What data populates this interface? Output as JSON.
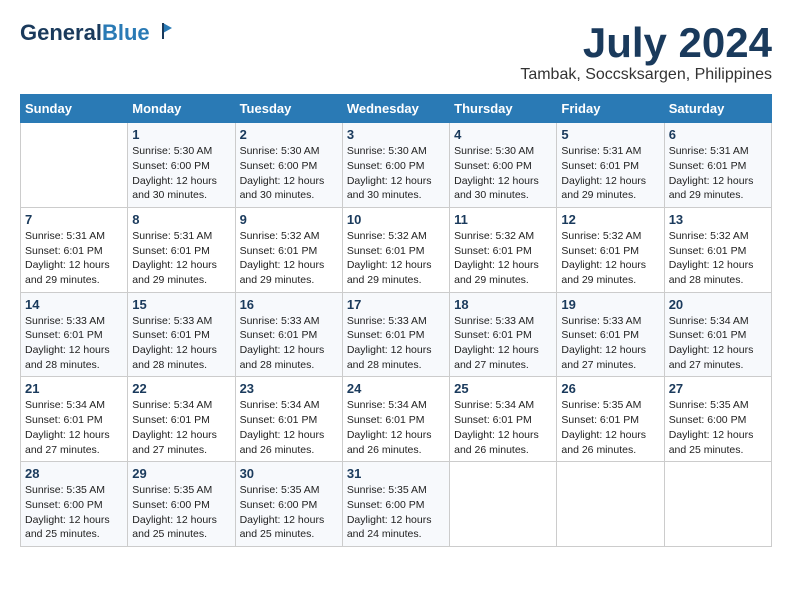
{
  "header": {
    "logo_general": "General",
    "logo_blue": "Blue",
    "month_year": "July 2024",
    "location": "Tambak, Soccsksargen, Philippines"
  },
  "days_of_week": [
    "Sunday",
    "Monday",
    "Tuesday",
    "Wednesday",
    "Thursday",
    "Friday",
    "Saturday"
  ],
  "weeks": [
    [
      {
        "day": "",
        "text": ""
      },
      {
        "day": "1",
        "text": "Sunrise: 5:30 AM\nSunset: 6:00 PM\nDaylight: 12 hours\nand 30 minutes."
      },
      {
        "day": "2",
        "text": "Sunrise: 5:30 AM\nSunset: 6:00 PM\nDaylight: 12 hours\nand 30 minutes."
      },
      {
        "day": "3",
        "text": "Sunrise: 5:30 AM\nSunset: 6:00 PM\nDaylight: 12 hours\nand 30 minutes."
      },
      {
        "day": "4",
        "text": "Sunrise: 5:30 AM\nSunset: 6:00 PM\nDaylight: 12 hours\nand 30 minutes."
      },
      {
        "day": "5",
        "text": "Sunrise: 5:31 AM\nSunset: 6:01 PM\nDaylight: 12 hours\nand 29 minutes."
      },
      {
        "day": "6",
        "text": "Sunrise: 5:31 AM\nSunset: 6:01 PM\nDaylight: 12 hours\nand 29 minutes."
      }
    ],
    [
      {
        "day": "7",
        "text": "Sunrise: 5:31 AM\nSunset: 6:01 PM\nDaylight: 12 hours\nand 29 minutes."
      },
      {
        "day": "8",
        "text": "Sunrise: 5:31 AM\nSunset: 6:01 PM\nDaylight: 12 hours\nand 29 minutes."
      },
      {
        "day": "9",
        "text": "Sunrise: 5:32 AM\nSunset: 6:01 PM\nDaylight: 12 hours\nand 29 minutes."
      },
      {
        "day": "10",
        "text": "Sunrise: 5:32 AM\nSunset: 6:01 PM\nDaylight: 12 hours\nand 29 minutes."
      },
      {
        "day": "11",
        "text": "Sunrise: 5:32 AM\nSunset: 6:01 PM\nDaylight: 12 hours\nand 29 minutes."
      },
      {
        "day": "12",
        "text": "Sunrise: 5:32 AM\nSunset: 6:01 PM\nDaylight: 12 hours\nand 29 minutes."
      },
      {
        "day": "13",
        "text": "Sunrise: 5:32 AM\nSunset: 6:01 PM\nDaylight: 12 hours\nand 28 minutes."
      }
    ],
    [
      {
        "day": "14",
        "text": "Sunrise: 5:33 AM\nSunset: 6:01 PM\nDaylight: 12 hours\nand 28 minutes."
      },
      {
        "day": "15",
        "text": "Sunrise: 5:33 AM\nSunset: 6:01 PM\nDaylight: 12 hours\nand 28 minutes."
      },
      {
        "day": "16",
        "text": "Sunrise: 5:33 AM\nSunset: 6:01 PM\nDaylight: 12 hours\nand 28 minutes."
      },
      {
        "day": "17",
        "text": "Sunrise: 5:33 AM\nSunset: 6:01 PM\nDaylight: 12 hours\nand 28 minutes."
      },
      {
        "day": "18",
        "text": "Sunrise: 5:33 AM\nSunset: 6:01 PM\nDaylight: 12 hours\nand 27 minutes."
      },
      {
        "day": "19",
        "text": "Sunrise: 5:33 AM\nSunset: 6:01 PM\nDaylight: 12 hours\nand 27 minutes."
      },
      {
        "day": "20",
        "text": "Sunrise: 5:34 AM\nSunset: 6:01 PM\nDaylight: 12 hours\nand 27 minutes."
      }
    ],
    [
      {
        "day": "21",
        "text": "Sunrise: 5:34 AM\nSunset: 6:01 PM\nDaylight: 12 hours\nand 27 minutes."
      },
      {
        "day": "22",
        "text": "Sunrise: 5:34 AM\nSunset: 6:01 PM\nDaylight: 12 hours\nand 27 minutes."
      },
      {
        "day": "23",
        "text": "Sunrise: 5:34 AM\nSunset: 6:01 PM\nDaylight: 12 hours\nand 26 minutes."
      },
      {
        "day": "24",
        "text": "Sunrise: 5:34 AM\nSunset: 6:01 PM\nDaylight: 12 hours\nand 26 minutes."
      },
      {
        "day": "25",
        "text": "Sunrise: 5:34 AM\nSunset: 6:01 PM\nDaylight: 12 hours\nand 26 minutes."
      },
      {
        "day": "26",
        "text": "Sunrise: 5:35 AM\nSunset: 6:01 PM\nDaylight: 12 hours\nand 26 minutes."
      },
      {
        "day": "27",
        "text": "Sunrise: 5:35 AM\nSunset: 6:00 PM\nDaylight: 12 hours\nand 25 minutes."
      }
    ],
    [
      {
        "day": "28",
        "text": "Sunrise: 5:35 AM\nSunset: 6:00 PM\nDaylight: 12 hours\nand 25 minutes."
      },
      {
        "day": "29",
        "text": "Sunrise: 5:35 AM\nSunset: 6:00 PM\nDaylight: 12 hours\nand 25 minutes."
      },
      {
        "day": "30",
        "text": "Sunrise: 5:35 AM\nSunset: 6:00 PM\nDaylight: 12 hours\nand 25 minutes."
      },
      {
        "day": "31",
        "text": "Sunrise: 5:35 AM\nSunset: 6:00 PM\nDaylight: 12 hours\nand 24 minutes."
      },
      {
        "day": "",
        "text": ""
      },
      {
        "day": "",
        "text": ""
      },
      {
        "day": "",
        "text": ""
      }
    ]
  ]
}
